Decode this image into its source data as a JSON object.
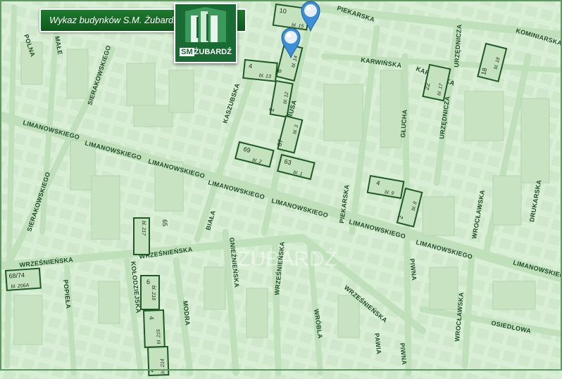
{
  "header": {
    "title": "Wykaz budynków S.M. Żubardź"
  },
  "logo": {
    "brand_bold": "SM",
    "brand_rest": "ŻUBARDŹ"
  },
  "watermark": {
    "text": "ŻUBARDŹ"
  },
  "streets": [
    {
      "name": "POLNA"
    },
    {
      "name": "MAŁE"
    },
    {
      "name": "SIERAKOWSKIEGO"
    },
    {
      "name": "SIERAKOWSKIEGO"
    },
    {
      "name": "LIMANOWSKIEGO"
    },
    {
      "name": "LIMANOWSKIEGO"
    },
    {
      "name": "LIMANOWSKIEGO"
    },
    {
      "name": "LIMANOWSKIEGO"
    },
    {
      "name": "LIMANOWSKIEGO"
    },
    {
      "name": "LIMANOWSKIEGO"
    },
    {
      "name": "LIMANOWSKIEGO"
    },
    {
      "name": "LIMANOWSKIEGO"
    },
    {
      "name": "KASZUBSKA"
    },
    {
      "name": "PRUSA"
    },
    {
      "name": "BIAŁA"
    },
    {
      "name": "PIEKARSKA"
    },
    {
      "name": "PIEKARSKA"
    },
    {
      "name": "KARWIŃSKA"
    },
    {
      "name": "KARWIŃSKA"
    },
    {
      "name": "GŁUCHA"
    },
    {
      "name": "URZĘDNICZA"
    },
    {
      "name": "URZĘDNICZA"
    },
    {
      "name": "KOMINIARSKA"
    },
    {
      "name": "DRUKARSKA"
    },
    {
      "name": "WROCŁAWSKA"
    },
    {
      "name": "WROCŁAWSKA"
    },
    {
      "name": "WRZEŚNIEŃSKA"
    },
    {
      "name": "WRZEŚNIEŃSKA"
    },
    {
      "name": "WRZEŚNIEŃSKA"
    },
    {
      "name": "WRZEŚNIEŃSKA"
    },
    {
      "name": "GNIEŹNIEŃSKA"
    },
    {
      "name": "KOŁODZIEJSKA"
    },
    {
      "name": "POPIEŁA"
    },
    {
      "name": "MODRA"
    },
    {
      "name": "WRÓBLA"
    },
    {
      "name": "PAWIA"
    },
    {
      "name": "PIWNA"
    },
    {
      "name": "PIWNA"
    },
    {
      "name": "OSIEDLOWA"
    }
  ],
  "buildings": [
    {
      "num": "10",
      "label": "bl. 15"
    },
    {
      "num": "4",
      "label": "bl. 13"
    },
    {
      "num": "6",
      "label": "bl. 14"
    },
    {
      "num": "2",
      "label": "bl. 12"
    },
    {
      "num": "67",
      "label": "bl. 3"
    },
    {
      "num": "69",
      "label": "bl. 2"
    },
    {
      "num": "63",
      "label": "bl. 1"
    },
    {
      "num": "4",
      "label": "bl. 9"
    },
    {
      "num": "2",
      "label": "bl. 8"
    },
    {
      "num": "22",
      "label": "bl. 17"
    },
    {
      "num": "18",
      "label": "bl. 18"
    },
    {
      "num": "65",
      "label": "bl. 217"
    },
    {
      "num": "68/74",
      "label": "bl. 206A"
    },
    {
      "num": "6",
      "label": "bl. 216"
    },
    {
      "num": "4",
      "label": "bl. 215"
    },
    {
      "num": "2",
      "label": "bl. 214"
    }
  ],
  "markers": [
    {
      "name": "marker-1"
    },
    {
      "name": "marker-2"
    }
  ],
  "colors": {
    "map_bg": "#d6ecd3",
    "road": "#b9dcb4",
    "street_text": "#1f4d28",
    "building_outline": "#1d5a25",
    "building_fill": "#c4e2bd",
    "header": "#0d5a1c",
    "marker": "#3a8fd8"
  }
}
